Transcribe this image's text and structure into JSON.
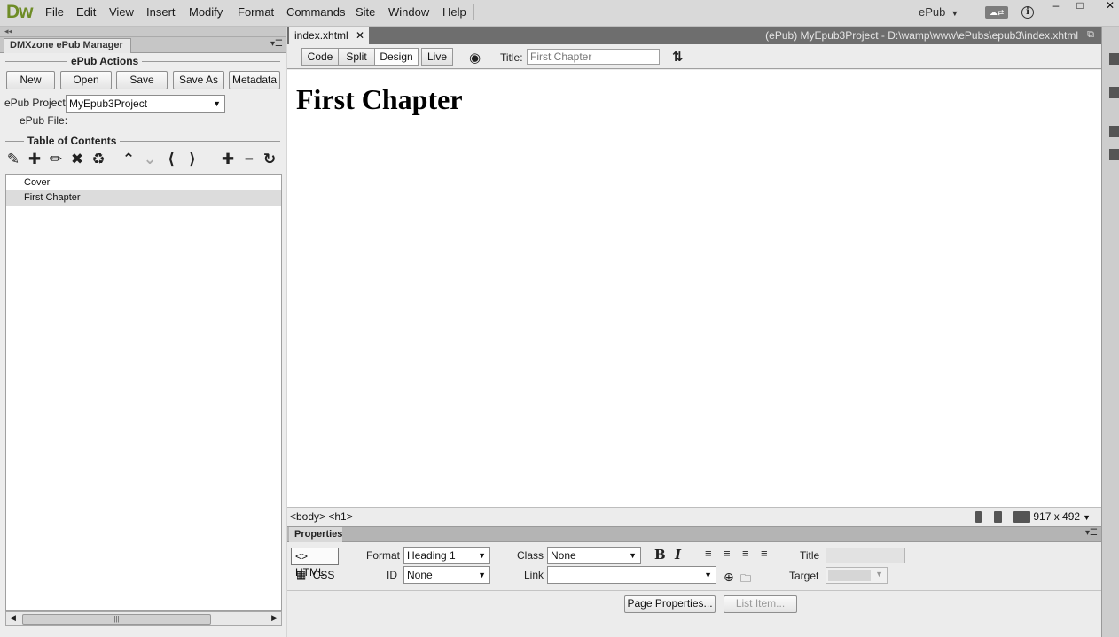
{
  "app": {
    "logo": "Dw",
    "menu": [
      "File",
      "Edit",
      "View",
      "Insert",
      "Modify",
      "Format",
      "Commands",
      "Site",
      "Window",
      "Help"
    ],
    "workspace": "ePub",
    "sync_label": "☁⇄",
    "info_label": "i",
    "window_buttons": [
      "–",
      "□",
      "✕"
    ]
  },
  "left_panel": {
    "strip_label": "◂◂",
    "tab": "DMXzone ePub Manager",
    "menu_icon": "▾☰",
    "actions_title": "ePub Actions",
    "buttons": {
      "new": "New",
      "open": "Open",
      "save": "Save",
      "save_as": "Save As",
      "metadata": "Metadata"
    },
    "project_label": "ePub Project:",
    "project_value": "MyEpub3Project",
    "file_label": "ePub File:",
    "toc_title": "Table of Contents",
    "toc_items": [
      "Cover",
      "First Chapter"
    ],
    "scroll_grip": "|||"
  },
  "document": {
    "tab": "index.xhtml",
    "tab_close": "✕",
    "path": "(ePub) MyEpub3Project - D:\\wamp\\www\\ePubs\\epub3\\index.xhtml",
    "restore_icon": "⧉",
    "views": {
      "code": "Code",
      "split": "Split",
      "design": "Design",
      "live": "Live"
    },
    "active_view": "Design",
    "title_label": "Title:",
    "title_value": "First Chapter",
    "heading": "First Chapter",
    "tag_selector": "<body> <h1>",
    "window_size": "917 x 492"
  },
  "properties": {
    "tab": "Properties",
    "menu_icon": "▾☰",
    "html_label": "HTML",
    "css_label": "CSS",
    "format_label": "Format",
    "format_value": "Heading 1",
    "class_label": "Class",
    "class_value": "None",
    "id_label": "ID",
    "id_value": "None",
    "link_label": "Link",
    "link_value": "",
    "title_label": "Title",
    "target_label": "Target",
    "bold": "B",
    "italic": "I",
    "page_properties": "Page Properties...",
    "list_item": "List Item..."
  },
  "colors": {
    "logo_green": "#6e8c26",
    "tab_bar_dark": "#6e6e6e",
    "panel_bg": "#ededed"
  }
}
